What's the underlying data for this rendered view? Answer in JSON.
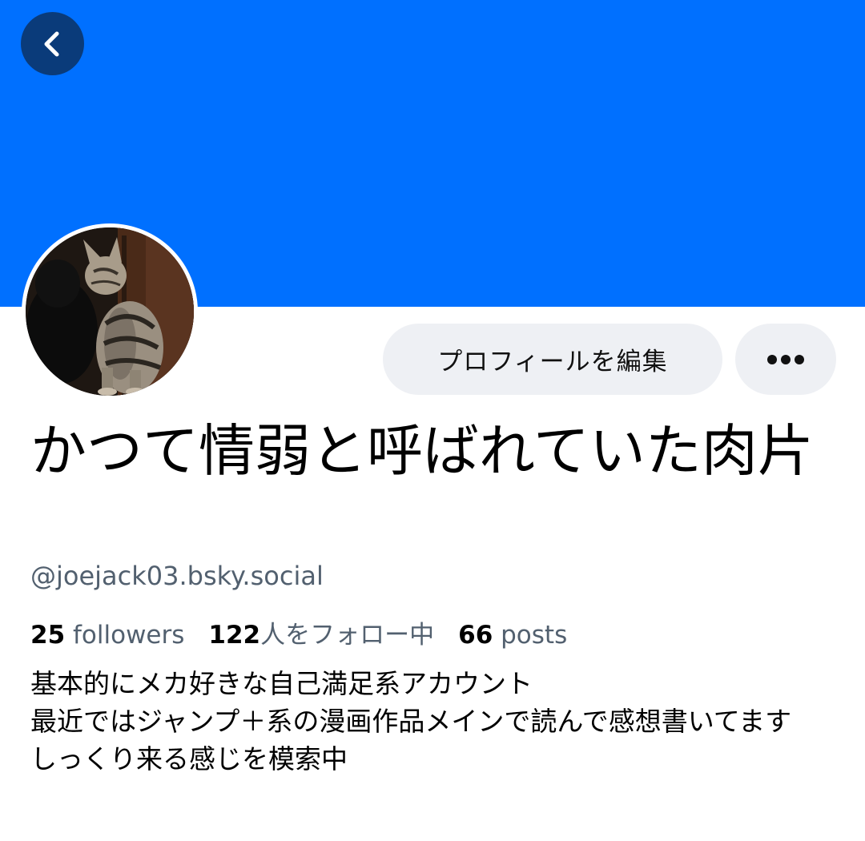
{
  "profile": {
    "display_name": "かつて情弱と呼ばれていた肉片",
    "handle": "@joejack03.bsky.social",
    "stats": {
      "followers_count": "25",
      "followers_label": "followers",
      "following_count": "122",
      "following_label": "人をフォロー中",
      "posts_count": "66",
      "posts_label": "posts"
    },
    "bio": [
      "基本的にメカ好きな自己満足系アカウント",
      "最近ではジャンプ＋系の漫画作品メインで読んで感想書いてます",
      "しっくり来る感じを模索中"
    ]
  },
  "actions": {
    "edit_profile_label": "プロフィールを編集",
    "back_icon": "chevron-left-icon",
    "more_icon": "ellipsis-icon"
  },
  "colors": {
    "banner": "#0070ff",
    "back_button": "#0a3b7a",
    "pill_button": "#eef0f4",
    "secondary_text": "#52606f"
  }
}
